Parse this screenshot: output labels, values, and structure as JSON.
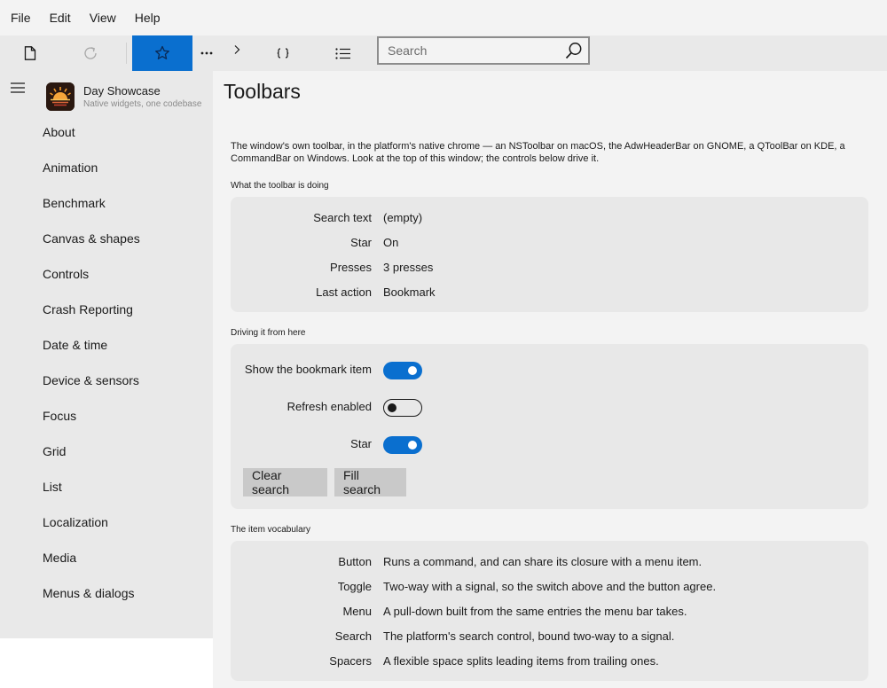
{
  "menubar": {
    "items": [
      "File",
      "Edit",
      "View",
      "Help"
    ]
  },
  "toolbar": {
    "buttons": {
      "new": "document-icon",
      "refresh": "refresh-icon",
      "star": "star-icon",
      "more": "ellipsis-icon",
      "chevron": "chevron-right-icon",
      "braces": "braces-icon",
      "list": "list-icon"
    },
    "search": {
      "placeholder": "Search",
      "value": ""
    },
    "accent": "#0a6fcf"
  },
  "sidebar": {
    "app_name": "Day Showcase",
    "app_tagline": "Native widgets, one codebase",
    "items": [
      "About",
      "Animation",
      "Benchmark",
      "Canvas & shapes",
      "Controls",
      "Crash Reporting",
      "Date & time",
      "Device & sensors",
      "Focus",
      "Grid",
      "List",
      "Localization",
      "Media",
      "Menus & dialogs"
    ]
  },
  "page": {
    "title": "Toolbars",
    "intro": "The window's own toolbar, in the platform's native chrome — an NSToolbar on macOS, the AdwHeaderBar on GNOME, a QToolBar on KDE, a CommandBar on Windows. Look at the top of this window; the controls below drive it.",
    "status_section": {
      "title": "What the toolbar is doing",
      "rows": [
        {
          "label": "Search text",
          "value": "(empty)"
        },
        {
          "label": "Star",
          "value": "On"
        },
        {
          "label": "Presses",
          "value": "3 presses"
        },
        {
          "label": "Last action",
          "value": "Bookmark"
        }
      ]
    },
    "drive_section": {
      "title": "Driving it from here",
      "toggles": [
        {
          "label": "Show the bookmark item",
          "on": true
        },
        {
          "label": "Refresh enabled",
          "on": false
        },
        {
          "label": "Star",
          "on": true
        }
      ],
      "clear_label": "Clear search",
      "fill_label": "Fill search"
    },
    "vocab_section": {
      "title": "The item vocabulary",
      "rows": [
        {
          "label": "Button",
          "value": "Runs a command, and can share its closure with a menu item."
        },
        {
          "label": "Toggle",
          "value": "Two-way with a signal, so the switch above and the button agree."
        },
        {
          "label": "Menu",
          "value": "A pull-down built from the same entries the menu bar takes."
        },
        {
          "label": "Search",
          "value": "The platform's search control, bound two-way to a signal."
        },
        {
          "label": "Spacers",
          "value": "A flexible space splits leading items from trailing ones."
        }
      ]
    }
  }
}
